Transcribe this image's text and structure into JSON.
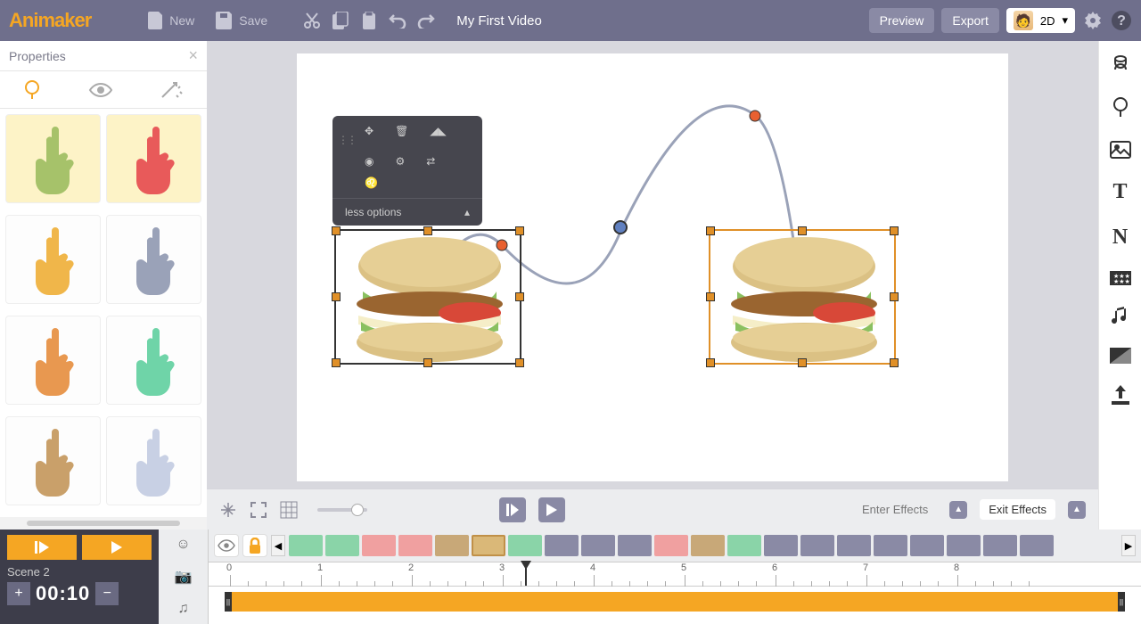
{
  "topbar": {
    "logo": "Animaker",
    "new_label": "New",
    "save_label": "Save",
    "project_title": "My First Video",
    "preview_label": "Preview",
    "export_label": "Export",
    "mode_label": "2D"
  },
  "properties": {
    "title": "Properties",
    "hand_colors": [
      "#a6c26a",
      "#e85a5a",
      "#f0b64a",
      "#9aa2b8",
      "#e89850",
      "#6fd4a8",
      "#c9a06a",
      "#c8d0e4"
    ]
  },
  "context_menu": {
    "less_options": "less options"
  },
  "canvas_bar": {
    "enter_effects": "Enter Effects",
    "exit_effects": "Exit Effects"
  },
  "timeline": {
    "scene_label": "Scene 2",
    "time": "00:10",
    "ruler_ticks": [
      "0",
      "1",
      "2",
      "3",
      "4",
      "5",
      "6",
      "7",
      "8"
    ],
    "block_colors": [
      "#8ad4a8",
      "#8ad4a8",
      "#f0a0a0",
      "#f0a0a0",
      "#c8a878",
      "#dab878",
      "#8ad4a8",
      "#8a8aa5",
      "#8a8aa5",
      "#8a8aa5",
      "#f0a0a0",
      "#c8a878",
      "#8ad4a8",
      "#8a8aa5",
      "#8a8aa5",
      "#8a8aa5",
      "#8a8aa5",
      "#8a8aa5",
      "#8a8aa5",
      "#8a8aa5",
      "#8a8aa5"
    ]
  }
}
